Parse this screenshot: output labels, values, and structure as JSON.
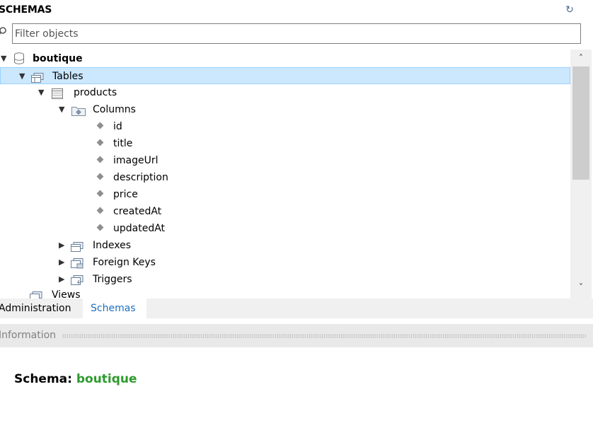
{
  "header": {
    "title": "SCHEMAS",
    "refresh_icon": "refresh-icon"
  },
  "filter": {
    "placeholder": "Filter objects",
    "icon": "search-icon"
  },
  "tree": {
    "schema": "boutique",
    "tables": "Tables",
    "table": "products",
    "columns": "Columns",
    "column_list": [
      "id",
      "title",
      "imageUrl",
      "description",
      "price",
      "createdAt",
      "updatedAt"
    ],
    "indexes": "Indexes",
    "foreign_keys": "Foreign Keys",
    "triggers": "Triggers",
    "views": "Views"
  },
  "tabs": {
    "administration": "Administration",
    "schemas": "Schemas",
    "active": "Schemas"
  },
  "info": {
    "title": "Information",
    "schema_label": "Schema:",
    "schema_value": "boutique"
  },
  "colors": {
    "selected_bg": "#cce8ff",
    "selected_border": "#99d1ff",
    "schema_value": "#2e9a2e",
    "active_tab": "#1e6fc2"
  }
}
